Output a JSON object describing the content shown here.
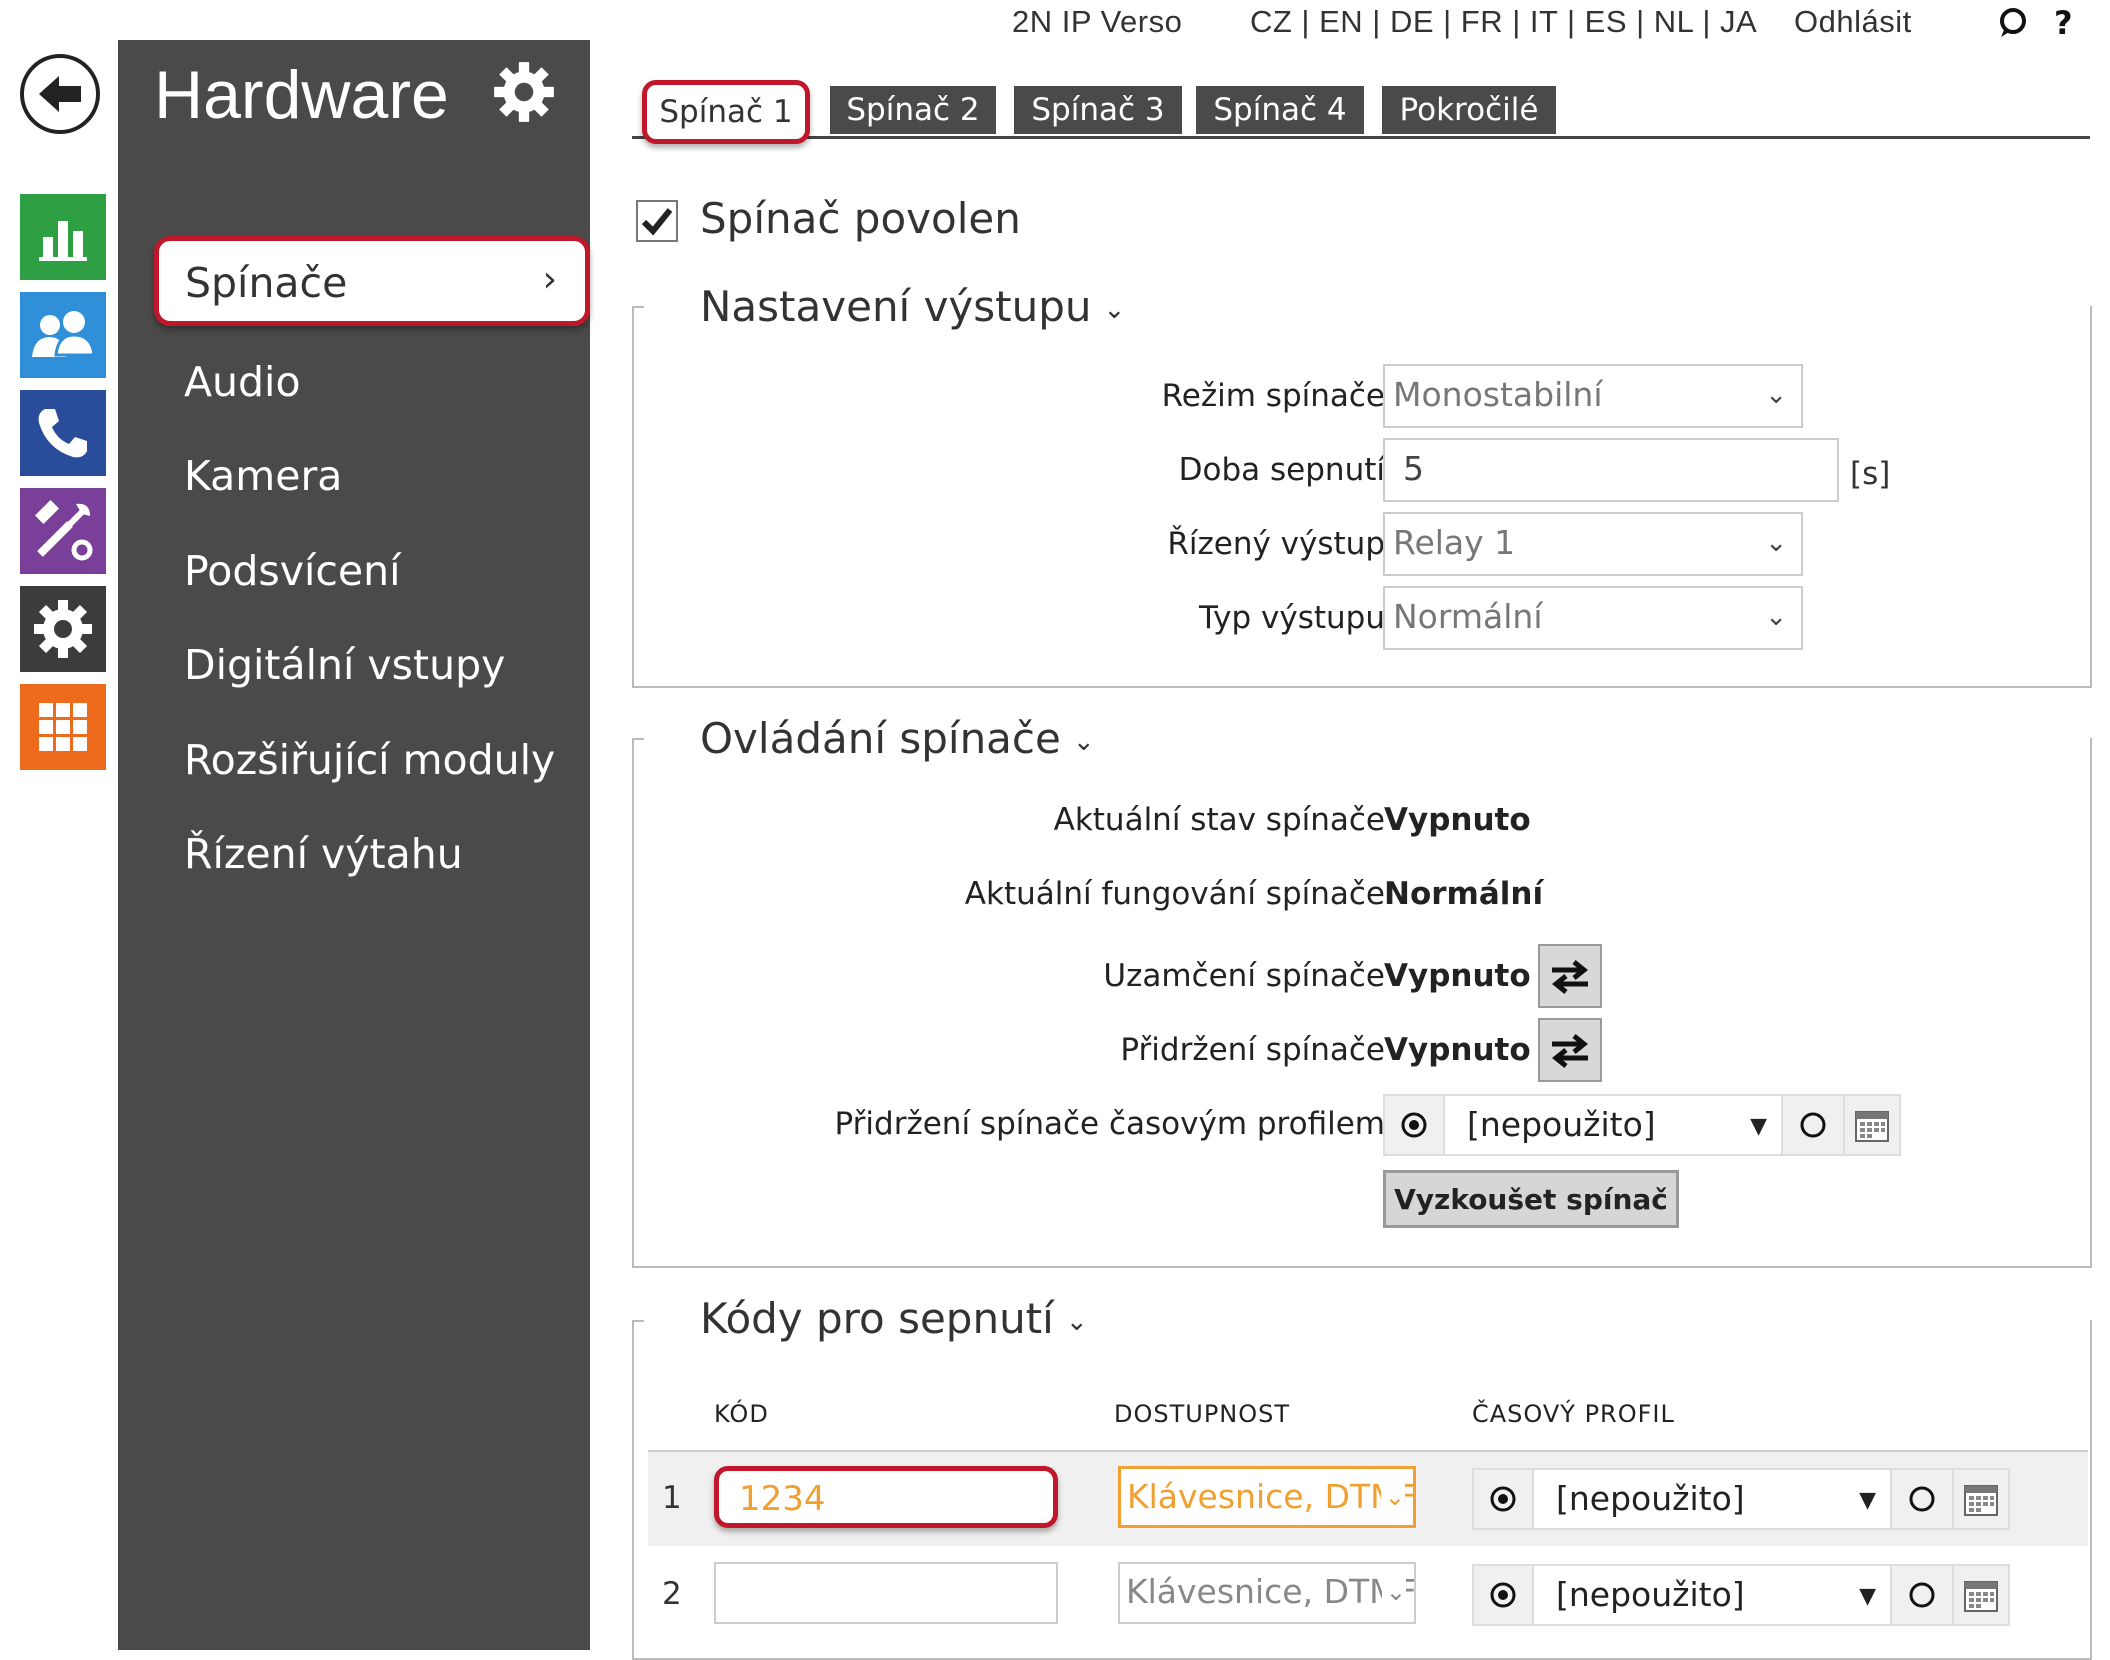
{
  "topbar": {
    "device": "2N IP Verso",
    "languages": "CZ | EN | DE | FR | IT | ES | NL | JA",
    "logout": "Odhlásit",
    "chat_icon": "chat-bubble-icon",
    "help": "?"
  },
  "rail": {
    "back_icon": "arrow-left-icon",
    "items": [
      {
        "icon": "status-chart-icon",
        "color": "#2ea043"
      },
      {
        "icon": "users-icon",
        "color": "#2f8fd8"
      },
      {
        "icon": "phone-icon",
        "color": "#2a4d9b"
      },
      {
        "icon": "services-tools-icon",
        "color": "#7a3f98"
      },
      {
        "icon": "gear-icon",
        "color": "#3c3c3c"
      },
      {
        "icon": "grid-icon",
        "color": "#ee6a1d"
      }
    ]
  },
  "sidebar": {
    "title": "Hardware",
    "items": [
      {
        "label": "Spínače",
        "active": true
      },
      {
        "label": "Audio"
      },
      {
        "label": "Kamera"
      },
      {
        "label": "Podsvícení"
      },
      {
        "label": "Digitální vstupy"
      },
      {
        "label": "Rozšiřující moduly"
      },
      {
        "label": "Řízení výtahu"
      }
    ],
    "chevron": "›"
  },
  "tabs": [
    "Spínač 1",
    "Spínač 2",
    "Spínač 3",
    "Spínač 4",
    "Pokročilé"
  ],
  "enabled": {
    "label": "Spínač povolen",
    "checked": true
  },
  "output_settings": {
    "title": "Nastavení výstupu",
    "mode_label": "Režim spínače",
    "mode_value": "Monostabilní",
    "duration_label": "Doba sepnutí",
    "duration_value": "5",
    "duration_unit": "[s]",
    "output_label": "Řízený výstup",
    "output_value": "Relay 1",
    "type_label": "Typ výstupu",
    "type_value": "Normální"
  },
  "switch_control": {
    "title": "Ovládání spínače",
    "state_label": "Aktuální stav spínače",
    "state_value": "Vypnuto",
    "operation_label": "Aktuální fungování spínače",
    "operation_value": "Normální",
    "lock_label": "Uzamčení spínače",
    "lock_value": "Vypnuto",
    "hold_label": "Přidržení spínače",
    "hold_value": "Vypnuto",
    "hold_profile_label": "Přidržení spínače časovým profilem",
    "hold_profile_value": "[nepoužito]",
    "test_button": "Vyzkoušet spínač"
  },
  "codes": {
    "title": "Kódy pro sepnutí",
    "col_code": "KÓD",
    "col_availability": "DOSTUPNOST",
    "col_profile": "ČASOVÝ PROFIL",
    "rows": [
      {
        "num": "1",
        "code": "1234",
        "availability": "Klávesnice, DTMF",
        "profile": "[nepoužito]"
      },
      {
        "num": "2",
        "code": "",
        "availability": "Klávesnice, DTMF",
        "profile": "[nepoužito]"
      }
    ]
  },
  "colors": {
    "sidebar_bg": "#4a4a4a",
    "highlight_red": "#c0182a",
    "accent_orange": "#f0a030"
  }
}
